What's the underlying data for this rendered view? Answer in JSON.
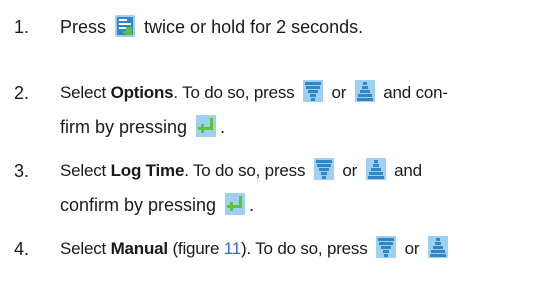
{
  "steps": [
    {
      "number": "1.",
      "lines": [
        {
          "before": "Press",
          "after": "twice or hold for 2 seconds."
        }
      ]
    },
    {
      "number": "2.",
      "lines": [
        {
          "pre": "Select ",
          "bold": "Options",
          "post": ". To do so, press",
          "or": "or",
          "tail": "and con-"
        },
        {
          "before": "firm by pressing",
          "after": "."
        }
      ]
    },
    {
      "number": "3.",
      "lines": [
        {
          "pre": "Select ",
          "bold": "Log Time",
          "post": ". To do so, press",
          "or": "or",
          "tail": "and"
        },
        {
          "before": "confirm by pressing",
          "after": "."
        }
      ]
    },
    {
      "number": "4.",
      "lines": [
        {
          "pre": "Select ",
          "bold": "Manual",
          "mid": " (figure ",
          "link": "11",
          "post": "). To do so, press",
          "or": "or"
        }
      ]
    }
  ],
  "icons": {
    "menu": "menu-icon",
    "down": "arrow-down-icon",
    "up": "arrow-up-icon",
    "enter": "enter-icon"
  },
  "colors": {
    "text": "#1a1a1a",
    "link": "#2e6bd6",
    "icon_blue": "#2f86c9",
    "icon_light": "#9fd0f0",
    "icon_green": "#5fc23a"
  }
}
